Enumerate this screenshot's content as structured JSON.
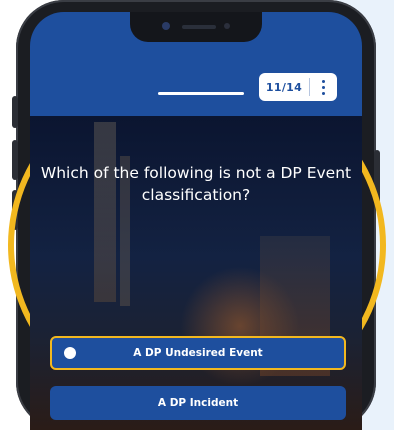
{
  "quiz": {
    "counter": "11/14",
    "question": "Which of the following is not a DP Event classification?",
    "answers": [
      {
        "label": "A DP Undesired Event"
      },
      {
        "label": "A DP Incident"
      }
    ]
  },
  "icons": {
    "menu": "more-vertical-icon",
    "radio": "radio-button-icon"
  },
  "colors": {
    "header_blue": "#1e4f9e",
    "ring_yellow": "#f2b81f",
    "answer_blue": "#1e4f9e"
  }
}
